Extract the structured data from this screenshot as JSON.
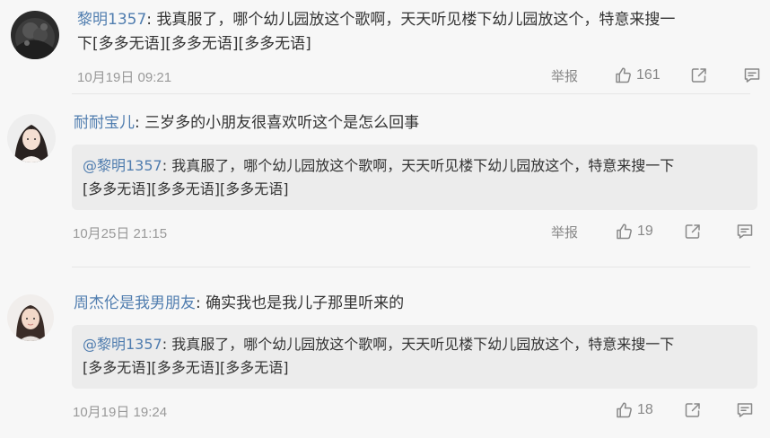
{
  "comments": [
    {
      "user": "黎明1357",
      "text_line1": "我真服了，哪个幼儿园放这个歌啊，天天听见楼下幼儿园放这个，特意来搜一",
      "text_line2": "下[多多无语][多多无语][多多无语]",
      "time": "10月19日 09:21",
      "report": "举报",
      "likes": "161"
    },
    {
      "user": "耐耐宝儿",
      "text": "三岁多的小朋友很喜欢听这个是怎么回事",
      "quote_user": "@黎明1357",
      "quote_line1": "我真服了，哪个幼儿园放这个歌啊，天天听见楼下幼儿园放这个，特意来搜一下",
      "quote_line2": "[多多无语][多多无语][多多无语]",
      "time": "10月25日 21:15",
      "report": "举报",
      "likes": "19"
    },
    {
      "user": "周杰伦是我男朋友",
      "text": "确实我也是我儿子那里听来的",
      "quote_user": "@黎明1357",
      "quote_line1": "我真服了，哪个幼儿园放这个歌啊，天天听见楼下幼儿园放这个，特意来搜一下",
      "quote_line2": "[多多无语][多多无语][多多无语]",
      "time": "10月19日 19:24",
      "likes": "18"
    }
  ],
  "colon": ":",
  "icons": [
    "thumb-up-icon",
    "share-icon",
    "comment-icon"
  ],
  "colors": {
    "username": "#507daf",
    "meta": "#999999",
    "quote_bg": "#ececec",
    "background": "#f7f7f7"
  }
}
